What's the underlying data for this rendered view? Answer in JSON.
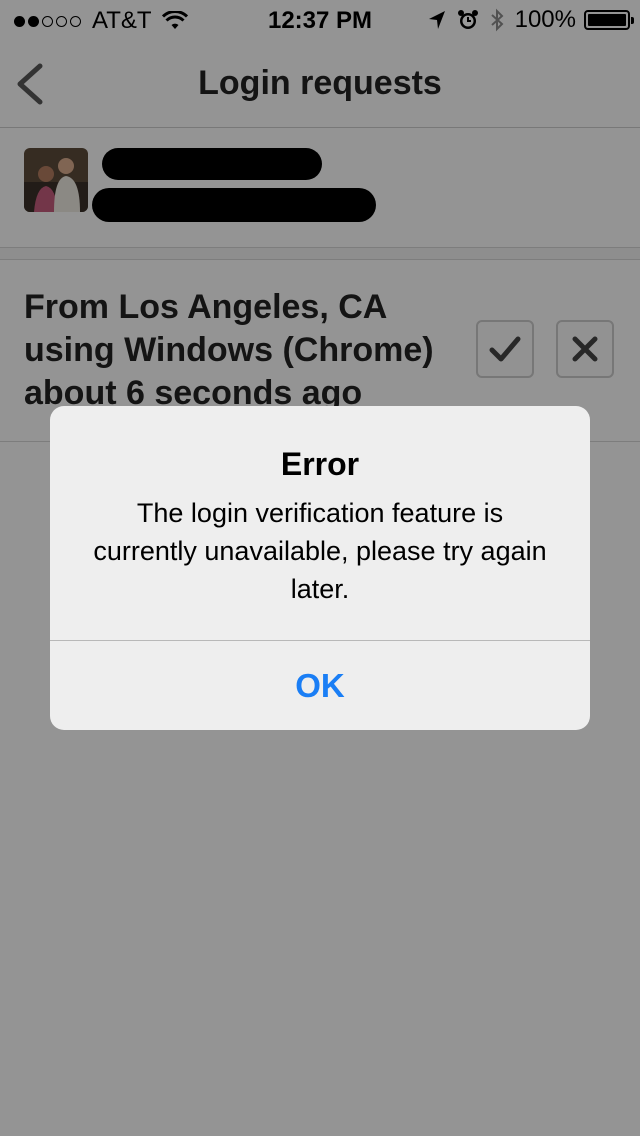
{
  "status_bar": {
    "carrier": "AT&T",
    "time": "12:37 PM",
    "battery": "100%",
    "signal_strength": 2,
    "icons": [
      "wifi-icon",
      "location-arrow-icon",
      "alarm-icon",
      "bluetooth-icon",
      "battery-icon"
    ]
  },
  "nav": {
    "title": "Login requests",
    "back_icon": "chevron-left-icon"
  },
  "user": {
    "avatar": "user-photo",
    "name_redacted": true
  },
  "request": {
    "line1": "From Los Angeles, CA",
    "line2": "using Windows (Chrome)",
    "line3": "about 6 seconds ago",
    "approve_icon": "checkmark-icon",
    "deny_icon": "x-icon"
  },
  "alert": {
    "title": "Error",
    "message": "The login verification feature is currently unavailable, please try again later.",
    "ok_label": "OK"
  },
  "colors": {
    "accent": "#1a7ef5",
    "overlay": "rgba(0,0,0,0.40)",
    "background": "#f7f7f7"
  }
}
